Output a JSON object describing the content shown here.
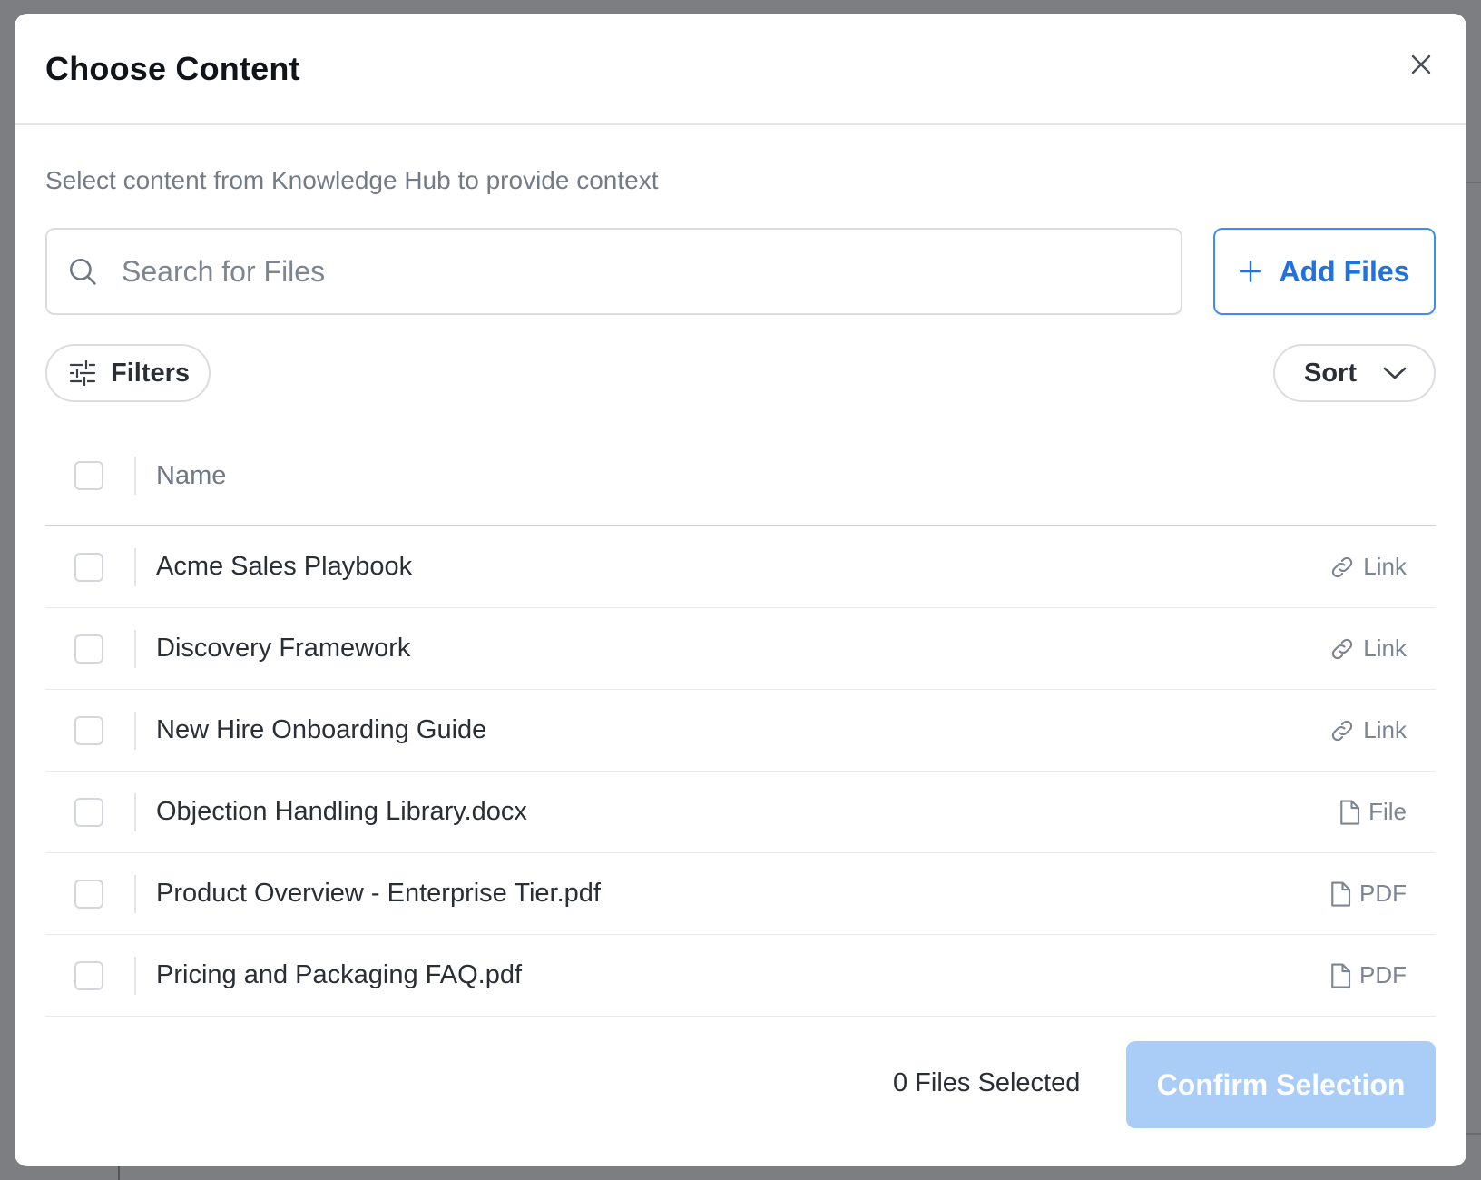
{
  "modal": {
    "title": "Choose Content",
    "subtitle": "Select content from Knowledge Hub to provide context",
    "close_icon": "close-icon"
  },
  "search": {
    "placeholder": "Search for Files",
    "value": "",
    "icon": "search-icon"
  },
  "actions": {
    "add_files_label": "Add Files",
    "add_files_icon": "plus-icon",
    "filters_label": "Filters",
    "filters_icon": "sliders-icon",
    "sort_label": "Sort",
    "sort_icon": "chevron-down-icon"
  },
  "table": {
    "header_name": "Name",
    "rows": [
      {
        "name": "Acme Sales Playbook",
        "type": "Link",
        "icon": "link-icon",
        "checked": false
      },
      {
        "name": "Discovery Framework",
        "type": "Link",
        "icon": "link-icon",
        "checked": false
      },
      {
        "name": "New Hire Onboarding Guide",
        "type": "Link",
        "icon": "link-icon",
        "checked": false
      },
      {
        "name": "Objection Handling Library.docx",
        "type": "File",
        "icon": "file-icon",
        "checked": false
      },
      {
        "name": "Product Overview - Enterprise Tier.pdf",
        "type": "PDF",
        "icon": "file-icon",
        "checked": false
      },
      {
        "name": "Pricing and Packaging FAQ.pdf",
        "type": "PDF",
        "icon": "file-icon",
        "checked": false
      }
    ]
  },
  "footer": {
    "selected_count_label": "0 Files Selected",
    "confirm_label": "Confirm Selection",
    "confirm_disabled": true
  },
  "colors": {
    "accent": "#1f73e0",
    "accent_border": "#3d8ef0",
    "confirm_disabled_bg": "#a9cdf6",
    "backdrop": "#7d7e81"
  }
}
